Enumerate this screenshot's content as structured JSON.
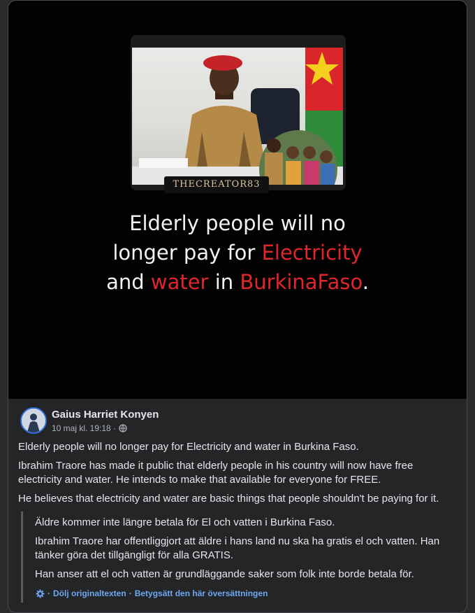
{
  "media": {
    "watermark": "THECREATOR83",
    "headline": {
      "line1": "Elderly people will no",
      "line2a": "longer pay for ",
      "line2b": "Electricity",
      "line3a": "and ",
      "line3b": "water",
      "line3c": " in ",
      "line3d": "BurkinaFaso",
      "line3e": "."
    },
    "accent_color": "#e0262b"
  },
  "post": {
    "author": "Gaius Harriet Konyen",
    "timestamp": "10 maj kl. 19:18 ·",
    "privacy_icon": "globe-icon",
    "paragraphs": [
      "Elderly people will no longer pay for Electricity and water in Burkina Faso.",
      "Ibrahim Traore has made it public that elderly people in his country will now have free electricity and water. He intends to make that available for everyone for FREE.",
      "He believes that electricity and water are basic things that people shouldn't be paying for it."
    ],
    "translation": {
      "paragraphs": [
        "Äldre kommer inte längre betala för El och vatten i Burkina Faso.",
        "Ibrahim Traore har offentliggjort att äldre i hans land nu ska ha gratis el och vatten. Han tänker göra det tillgängligt för alla GRATIS.",
        "Han anser att el och vatten är grundläggande saker som folk inte borde betala för."
      ],
      "hide_original": "Dölj originaltexten",
      "rate": "Betygsätt den här översättningen",
      "sep1": "·",
      "sep2": "·"
    }
  }
}
